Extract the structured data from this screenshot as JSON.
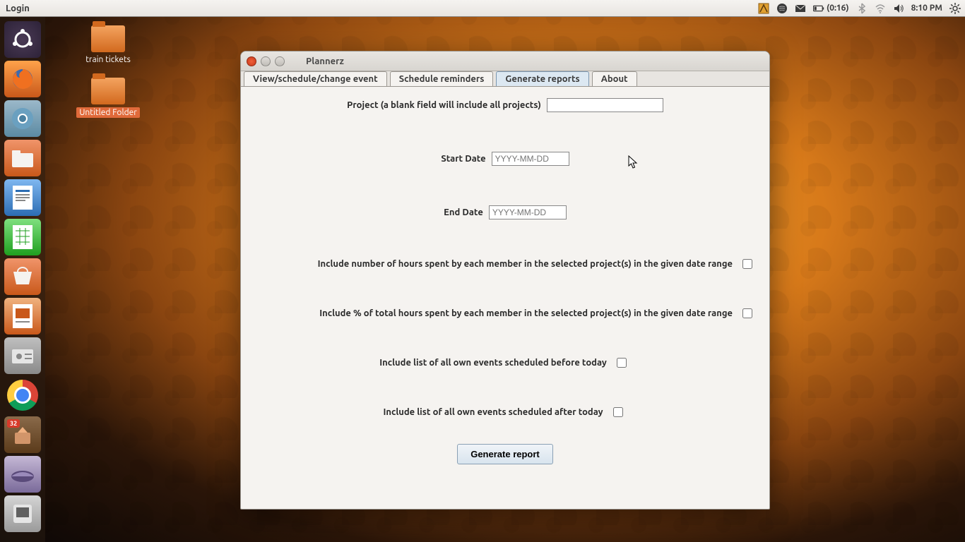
{
  "menubar": {
    "app_label": "Login",
    "battery": "(0:16)",
    "time": "8:10 PM"
  },
  "desktop": {
    "icon1_label": "train tickets",
    "icon2_label": "Untitled Folder"
  },
  "launcher": {
    "updates_badge": "32"
  },
  "window": {
    "title": "Plannerz",
    "tabs": [
      {
        "label": "View/schedule/change event"
      },
      {
        "label": "Schedule reminders"
      },
      {
        "label": "Generate reports"
      },
      {
        "label": "About"
      }
    ],
    "form": {
      "project_label": "Project (a blank field will include all projects)",
      "project_value": "",
      "start_label": "Start Date",
      "start_placeholder": "YYYY-MM-DD",
      "end_label": "End Date",
      "end_placeholder": "YYYY-MM-DD",
      "chk1_label": "Include number of hours spent by each member in the selected project(s) in the given date range",
      "chk2_label": "Include % of total hours spent by each member in the selected project(s) in the given date range",
      "chk3_label": "Include list of all own events scheduled before today",
      "chk4_label": "Include list of all own events scheduled after today",
      "button_label": "Generate report"
    }
  }
}
